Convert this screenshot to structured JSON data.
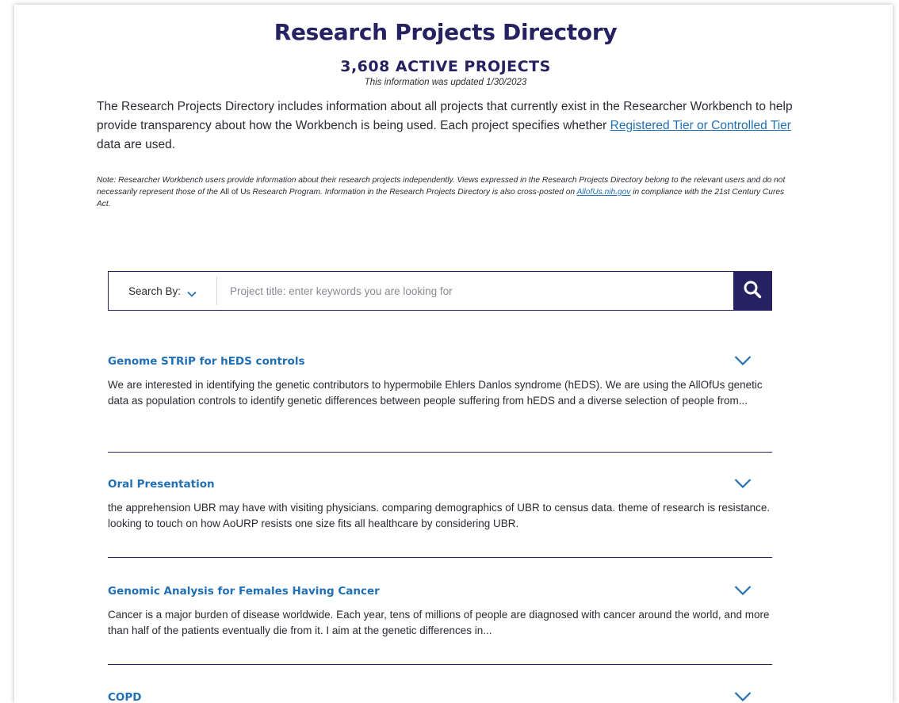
{
  "header": {
    "title": "Research Projects Directory",
    "active_count": "3,608 ACTIVE PROJECTS",
    "updated": "This information was updated 1/30/2023"
  },
  "intro": {
    "text_before": "The Research Projects Directory includes information about all projects that currently exist in the Researcher Workbench to help provide transparency about how the Workbench is being used. Each project specifies whether ",
    "link_label": "Registered Tier or Controlled Tier",
    "text_after": " data are used."
  },
  "note": {
    "part1": "Note: Researcher Workbench users provide information about their research projects independently. Views expressed in the Research Projects Directory belong to the relevant users and do not necessarily represent those of the ",
    "program_name": "All of Us",
    "part2": " Research Program. Information in the Research Projects Directory is also cross-posted on ",
    "link_label": "AllofUs.nih.gov",
    "part3": " in compliance with the 21st Century Cures Act."
  },
  "search": {
    "search_by_label": "Search By:",
    "placeholder": "Project title: enter keywords you are looking for",
    "value": "",
    "button_icon": "search-icon"
  },
  "projects": [
    {
      "title": "Genome STRiP for hEDS controls",
      "description": "We are interested in identifying the genetic contributors to hypermobile Ehlers Danlos syndrome (hEDS). We are using the AllOfUs genetic data as population controls to identify genetic differences between people suffering from hEDS and a diverse selection of people from..."
    },
    {
      "title": "Oral Presentation",
      "description": "the apprehension UBR may have with visiting physicians. comparing demographics of UBR to census data. theme of research is resistance. looking to touch on how AoURP resists one size fits all healthcare by considering UBR."
    },
    {
      "title": "Genomic Analysis for Females Having Cancer",
      "description": "Cancer is a major burden of disease worldwide. Each year, tens of millions of people are diagnosed with cancer around the world, and more than half of the patients eventually die from it. I aim at the genetic differences in..."
    },
    {
      "title": "COPD",
      "description": ""
    }
  ],
  "colors": {
    "navy": "#262262",
    "link_blue": "#216fb4",
    "text": "#2b2b33"
  }
}
